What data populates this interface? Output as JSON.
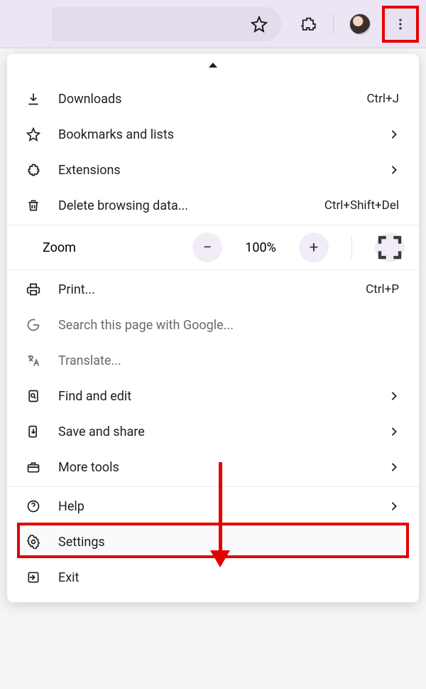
{
  "toolbar": {
    "star_title": "Bookmark this tab",
    "ext_title": "Extensions",
    "profile_title": "Profile",
    "kebab_title": "Customize and control Google Chrome"
  },
  "menu": {
    "sections": [
      [
        {
          "icon": "download-icon",
          "label": "Downloads",
          "accel": "Ctrl+J",
          "sub": false,
          "disabled": false
        },
        {
          "icon": "star-icon",
          "label": "Bookmarks and lists",
          "accel": "",
          "sub": true,
          "disabled": false
        },
        {
          "icon": "extension-icon",
          "label": "Extensions",
          "accel": "",
          "sub": true,
          "disabled": false
        },
        {
          "icon": "trash-icon",
          "label": "Delete browsing data...",
          "accel": "Ctrl+Shift+Del",
          "sub": false,
          "disabled": false
        }
      ],
      [
        {
          "icon": "print-icon",
          "label": "Print...",
          "accel": "Ctrl+P",
          "sub": false,
          "disabled": false
        },
        {
          "icon": "google-icon",
          "label": "Search this page with Google...",
          "accel": "",
          "sub": false,
          "disabled": true
        },
        {
          "icon": "translate-icon",
          "label": "Translate...",
          "accel": "",
          "sub": false,
          "disabled": true
        },
        {
          "icon": "find-icon",
          "label": "Find and edit",
          "accel": "",
          "sub": true,
          "disabled": false
        },
        {
          "icon": "share-icon",
          "label": "Save and share",
          "accel": "",
          "sub": true,
          "disabled": false
        },
        {
          "icon": "toolbox-icon",
          "label": "More tools",
          "accel": "",
          "sub": true,
          "disabled": false
        }
      ],
      [
        {
          "icon": "help-icon",
          "label": "Help",
          "accel": "",
          "sub": true,
          "disabled": false
        },
        {
          "icon": "settings-icon",
          "label": "Settings",
          "accel": "",
          "sub": false,
          "disabled": false
        },
        {
          "icon": "exit-icon",
          "label": "Exit",
          "accel": "",
          "sub": false,
          "disabled": false
        }
      ]
    ],
    "zoom": {
      "icon": "zoom-icon",
      "label": "Zoom",
      "value": "100%",
      "minus": "−",
      "plus": "+",
      "fullscreen_title": "Full screen"
    }
  },
  "annotations": {
    "highlight_kebab": true,
    "highlight_item_label": "Settings",
    "arrow_to": "Settings"
  }
}
